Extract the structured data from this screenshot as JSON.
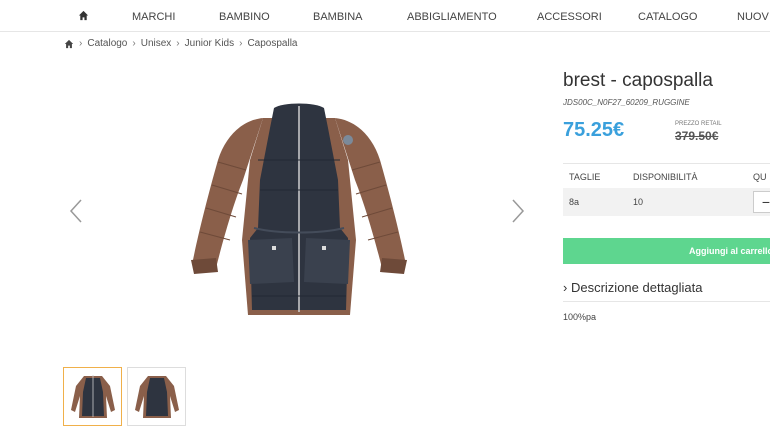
{
  "nav": {
    "items": [
      "MARCHI",
      "BAMBINO",
      "BAMBINA",
      "ABBIGLIAMENTO",
      "ACCESSORI",
      "CATALOGO",
      "NUOV"
    ]
  },
  "breadcrumb": [
    "Catalogo",
    "Unisex",
    "Junior Kids",
    "Capospalla"
  ],
  "product": {
    "title": "brest - capospalla",
    "sku": "JDS00C_N0F27_60209_RUGGINE",
    "price": "75.25€",
    "retail_label": "PREZZO RETAIL",
    "retail_price": "379.50€"
  },
  "sizes": {
    "headers": [
      "TAGLIE",
      "DISPONIBILITÀ",
      "QU"
    ],
    "rows": [
      {
        "size": "8a",
        "availability": "10"
      }
    ],
    "qty_minus": "−"
  },
  "cart": {
    "add_label": "Aggiungi al carrello"
  },
  "description": {
    "toggle_label": "Descrizione dettagliata",
    "text": "100%pa"
  },
  "colors": {
    "accent": "#3aa0dc",
    "cart": "#5ed68f",
    "jacket_brown": "#8a5f4a",
    "jacket_navy": "#2e3440",
    "thumb_active": "#f0b04a"
  },
  "icons": [
    "home-icon",
    "chevron-left-icon",
    "chevron-right-icon",
    "chevron-right-icon"
  ]
}
